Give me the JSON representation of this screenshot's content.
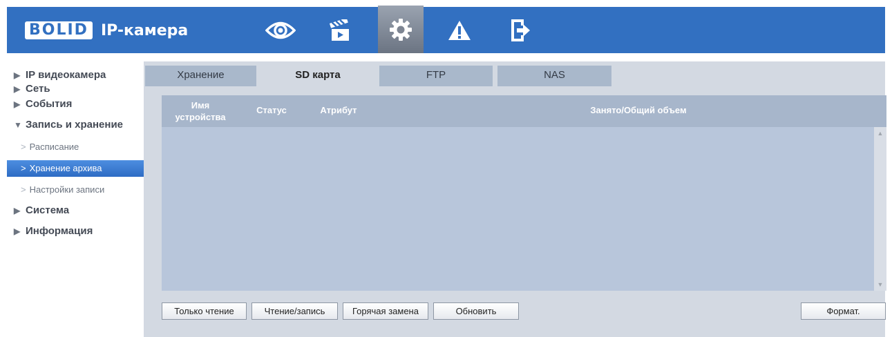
{
  "header": {
    "logo_text": "BOLID",
    "product": "IP-камера",
    "nav_icons": [
      "eye-icon",
      "clapperboard-icon",
      "gear-icon",
      "warning-icon",
      "logout-icon"
    ]
  },
  "sidebar": {
    "items": [
      {
        "label": "IP видеокамера"
      },
      {
        "label": "Сеть"
      },
      {
        "label": "События"
      },
      {
        "label": "Запись и хранение"
      },
      {
        "label": "Система"
      },
      {
        "label": "Информация"
      }
    ],
    "sub_items": [
      {
        "label": "Расписание"
      },
      {
        "label": "Хранение архива"
      },
      {
        "label": "Настройки записи"
      }
    ]
  },
  "tabs": [
    {
      "label": "Хранение"
    },
    {
      "label": "SD карта"
    },
    {
      "label": "FTP"
    },
    {
      "label": "NAS"
    }
  ],
  "table": {
    "col_name_1": "Имя",
    "col_name_2": "устройства",
    "col_status": "Статус",
    "col_attribute": "Атрибут",
    "col_capacity": "Занято/Общий объем"
  },
  "buttons": {
    "read_only": "Только чтение",
    "read_write": "Чтение/запись",
    "hot_swap": "Горячая замена",
    "refresh": "Обновить",
    "format": "Формат."
  },
  "colors": {
    "header": "#3270c1",
    "active_item": "#3a7bd1",
    "panel": "#d3d9e2",
    "table_header": "#a7b6cb",
    "table_body": "#b8c6db"
  }
}
